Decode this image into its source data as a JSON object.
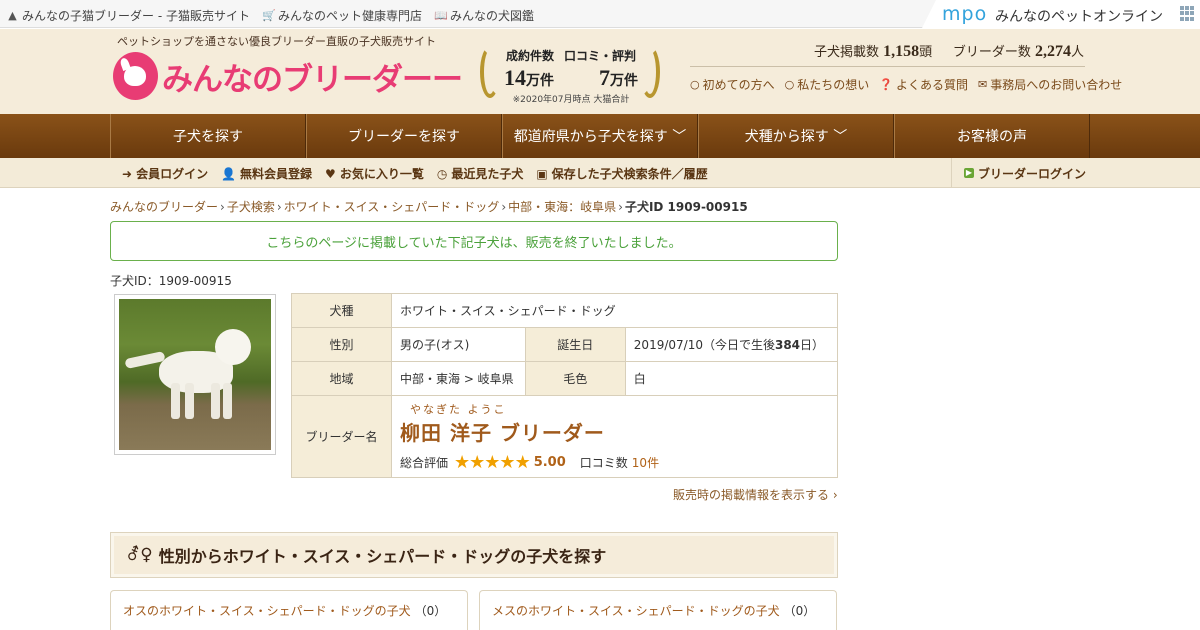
{
  "topbar": {
    "sites": [
      {
        "icon": "cat-icon",
        "label": "みんなの子猫ブリーダー - 子猫販売サイト"
      },
      {
        "icon": "cart-icon",
        "label": "みんなのペット健康専門店"
      },
      {
        "icon": "book-icon",
        "label": "みんなの犬図鑑"
      }
    ],
    "mpo_logo": "mpo",
    "mpo_text": "みんなのペットオンライン"
  },
  "header": {
    "tagline": "ペットショップを通さない優良ブリーダー直販の子犬販売サイト",
    "logo_a": "みんなの",
    "logo_b": "ブリーダー",
    "award": {
      "head1": "成約件数",
      "head2": "口コミ・評判",
      "num1": "14",
      "unit1": "万件",
      "num2": "7",
      "unit2": "万件",
      "note": "※2020年07月時点 大猫合計"
    },
    "stats": {
      "puppies_label": "子犬掲載数",
      "puppies_value": "1,158",
      "puppies_unit": "頭",
      "breeders_label": "ブリーダー数",
      "breeders_value": "2,274",
      "breeders_unit": "人"
    },
    "links": [
      "初めての方へ",
      "私たちの想い",
      "よくある質問",
      "事務局へのお問い合わせ"
    ]
  },
  "mainnav": [
    "子犬を探す",
    "ブリーダーを探す",
    "都道府県から子犬を探す ﹀",
    "犬種から探す ﹀",
    "お客様の声"
  ],
  "subnav": {
    "links": [
      "会員ログイン",
      "無料会員登録",
      "お気に入り一覧",
      "最近見た子犬",
      "保存した子犬検索条件／履歴"
    ],
    "breeder_login": "ブリーダーログイン"
  },
  "breadcrumb": {
    "items": [
      "みんなのブリーダー",
      "子犬検索",
      "ホワイト・スイス・シェパード・ドッグ",
      "中部・東海：岐阜県"
    ],
    "current": "子犬ID 1909-00915"
  },
  "notice": "こちらのページに掲載していた下記子犬は、販売を終了いたしました。",
  "puppy_id_label": "子犬ID：1909-00915",
  "details": {
    "breed_label": "犬種",
    "breed": "ホワイト・スイス・シェパード・ドッグ",
    "sex_label": "性別",
    "sex": "男の子(オス)",
    "birth_label": "誕生日",
    "birth": "2019/07/10（今日で生後",
    "birth_days": "384",
    "birth_suffix": "日）",
    "region_label": "地域",
    "region": "中部・東海 > 岐阜県",
    "color_label": "毛色",
    "color": "白",
    "breeder_label": "ブリーダー名",
    "breeder_ruby": "やなぎた ようこ",
    "breeder_name": "柳田 洋子 ブリーダー",
    "rating_label": "総合評価",
    "stars": "★★★★★",
    "rating": 5.0,
    "rating_text": "5.00",
    "reviews_label": "口コミ数",
    "reviews": "10件"
  },
  "more_link": "販売時の掲載情報を表示する ›",
  "section": {
    "title": "性別からホワイト・スイス・シェパード・ドッグの子犬を探す",
    "male": "オスのホワイト・スイス・シェパード・ドッグの子犬",
    "male_count": "（0）",
    "female": "メスのホワイト・スイス・シェパード・ドッグの子犬",
    "female_count": "（0）"
  }
}
